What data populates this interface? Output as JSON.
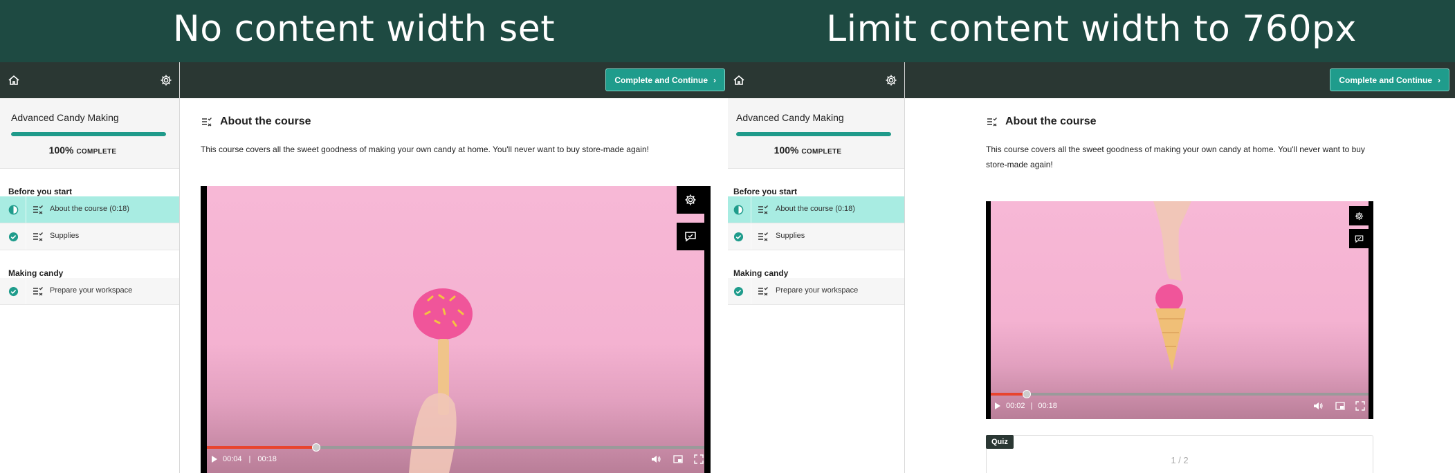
{
  "panels": {
    "left": {
      "banner_title": "No content width set"
    },
    "right": {
      "banner_title": "Limit content width to 760px"
    }
  },
  "course": {
    "title": "Advanced Candy Making",
    "progress_percent": 100,
    "progress_value": "100%",
    "progress_label": "COMPLETE"
  },
  "sections": [
    {
      "title": "Before you start",
      "lessons": [
        {
          "label": "About the course (0:18)",
          "status": "in-progress",
          "active": true
        },
        {
          "label": "Supplies",
          "status": "complete",
          "active": false
        }
      ]
    },
    {
      "title": "Making candy",
      "lessons": [
        {
          "label": "Prepare your workspace",
          "status": "complete",
          "active": false
        }
      ]
    }
  ],
  "topbar": {
    "cta_label": "Complete and Continue"
  },
  "lesson": {
    "title": "About the course",
    "description": "This course covers all the sweet goodness of making your own candy at home. You'll never want to buy store-made again!"
  },
  "video_left": {
    "current_time": "00:04",
    "duration": "00:18",
    "progress": 0.22
  },
  "video_right": {
    "current_time": "00:02",
    "duration": "00:18",
    "progress": 0.095
  },
  "quiz": {
    "badge": "Quiz",
    "counter": "1 / 2"
  },
  "icons": {
    "home": "home-icon",
    "settings": "gear-icon",
    "lesson_type": "checklist-icon",
    "complete": "check-circle-icon",
    "in_progress": "half-circle-icon",
    "video_settings": "gear-icon",
    "video_captions": "captions-icon",
    "play": "play-icon",
    "volume": "volume-icon",
    "pip": "picture-in-picture-icon",
    "fullscreen": "fullscreen-icon"
  },
  "colors": {
    "banner": "#1e4a42",
    "topbar": "#2a3733",
    "accent": "#1f9c8c",
    "active_lesson": "#a8ece2",
    "scrub_played": "#e8442e",
    "video_bg": "#f7b8d6"
  }
}
